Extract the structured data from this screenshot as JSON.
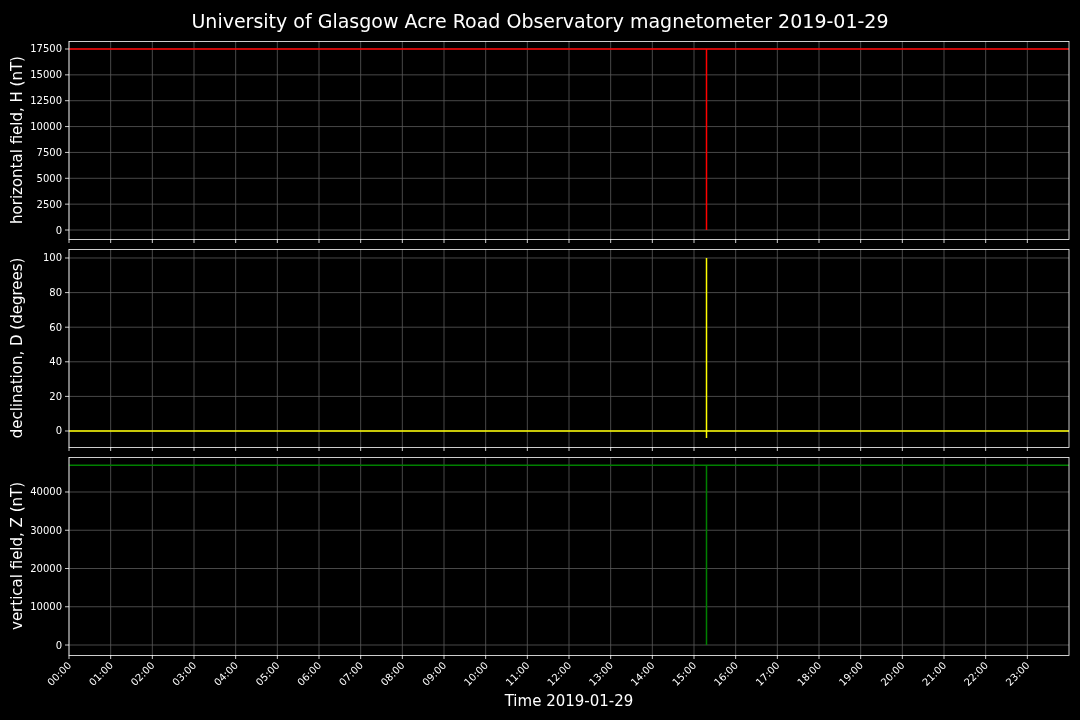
{
  "title": "University of Glasgow Acre Road Observatory magnetometer 2019-01-29",
  "panels": [
    {
      "chart_data": {
        "type": "line",
        "ylabel": "horizontal field, H (nT)",
        "xlim": [
          0,
          24
        ],
        "ylim": [
          -870,
          18273
        ],
        "grid": true,
        "yticks": [
          0,
          2500,
          5000,
          7500,
          10000,
          12500,
          15000,
          17500
        ],
        "x": [
          0,
          15.3,
          15.3,
          15.3,
          24
        ],
        "series": [
          {
            "color": "#ff0000",
            "values": [
              17500,
              17500,
              0,
              17500,
              17500
            ]
          }
        ]
      }
    },
    {
      "chart_data": {
        "type": "line",
        "ylabel": "declination, D (degrees)",
        "xlim": [
          0,
          24
        ],
        "ylim": [
          -9.25,
          105.2
        ],
        "grid": true,
        "yticks": [
          0,
          20,
          40,
          60,
          80,
          100
        ],
        "x": [
          0,
          15.3,
          15.3,
          15.3,
          15.3,
          24
        ],
        "series": [
          {
            "color": "#ffff00",
            "values": [
              0,
              0,
              100,
              -4,
              0,
              0
            ]
          }
        ]
      }
    },
    {
      "chart_data": {
        "type": "line",
        "ylabel": "vertical field, Z (nT)",
        "xlabel": "Time 2019-01-29",
        "xlim": [
          0,
          24
        ],
        "ylim": [
          -2614,
          49150
        ],
        "grid": true,
        "yticks": [
          0,
          10000,
          20000,
          30000,
          40000
        ],
        "x": [
          0,
          15.3,
          15.3,
          15.3,
          24
        ],
        "xticks": [
          {
            "value": 0,
            "label": "00:00"
          },
          {
            "value": 1,
            "label": "01:00"
          },
          {
            "value": 2,
            "label": "02:00"
          },
          {
            "value": 3,
            "label": "03:00"
          },
          {
            "value": 4,
            "label": "04:00"
          },
          {
            "value": 5,
            "label": "05:00"
          },
          {
            "value": 6,
            "label": "06:00"
          },
          {
            "value": 7,
            "label": "07:00"
          },
          {
            "value": 8,
            "label": "08:00"
          },
          {
            "value": 9,
            "label": "09:00"
          },
          {
            "value": 10,
            "label": "10:00"
          },
          {
            "value": 11,
            "label": "11:00"
          },
          {
            "value": 12,
            "label": "12:00"
          },
          {
            "value": 13,
            "label": "13:00"
          },
          {
            "value": 14,
            "label": "14:00"
          },
          {
            "value": 15,
            "label": "15:00"
          },
          {
            "value": 16,
            "label": "16:00"
          },
          {
            "value": 17,
            "label": "17:00"
          },
          {
            "value": 18,
            "label": "18:00"
          },
          {
            "value": 19,
            "label": "19:00"
          },
          {
            "value": 20,
            "label": "20:00"
          },
          {
            "value": 21,
            "label": "21:00"
          },
          {
            "value": 22,
            "label": "22:00"
          },
          {
            "value": 23,
            "label": "23:00"
          }
        ],
        "series": [
          {
            "color": "#008000",
            "values": [
              47000,
              47000,
              0,
              47000,
              47000
            ]
          }
        ]
      }
    }
  ]
}
